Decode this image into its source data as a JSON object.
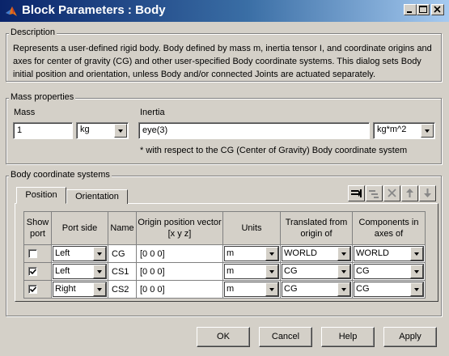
{
  "window": {
    "title": "Block Parameters : Body"
  },
  "description": {
    "legend": "Description",
    "text": "Represents a user-defined rigid body. Body defined by mass m, inertia tensor I, and coordinate origins and axes for center of gravity (CG) and other user-specified Body coordinate systems. This dialog sets Body initial position and orientation, unless Body and/or connected Joints are actuated separately."
  },
  "mass_properties": {
    "legend": "Mass properties",
    "mass_label": "Mass",
    "mass_value": "1",
    "mass_unit": "kg",
    "inertia_label": "Inertia",
    "inertia_value": "eye(3)",
    "inertia_unit": "kg*m^2",
    "inertia_note": "* with respect to the CG (Center of Gravity) Body coordinate system"
  },
  "body_cs": {
    "legend": "Body coordinate systems",
    "tabs": [
      {
        "label": "Position",
        "active": true
      },
      {
        "label": "Orientation",
        "active": false
      }
    ],
    "toolbar": [
      "add-row-icon",
      "delete-row-icon",
      "close-icon",
      "move-up-icon",
      "move-down-icon"
    ],
    "columns": [
      "Show port",
      "Port side",
      "Name",
      "Origin position vector [x y z]",
      "Units",
      "Translated from origin of",
      "Components in axes of"
    ],
    "rows": [
      {
        "show_port": false,
        "port_side": "Left",
        "name": "CG",
        "origin": "[0 0 0]",
        "units": "m",
        "translated_from": "WORLD",
        "components_in": "WORLD"
      },
      {
        "show_port": true,
        "port_side": "Left",
        "name": "CS1",
        "origin": "[0 0 0]",
        "units": "m",
        "translated_from": "CG",
        "components_in": "CG"
      },
      {
        "show_port": true,
        "port_side": "Right",
        "name": "CS2",
        "origin": "[0 0 0]",
        "units": "m",
        "translated_from": "CG",
        "components_in": "CG"
      }
    ]
  },
  "buttons": {
    "ok": "OK",
    "cancel": "Cancel",
    "help": "Help",
    "apply": "Apply"
  }
}
